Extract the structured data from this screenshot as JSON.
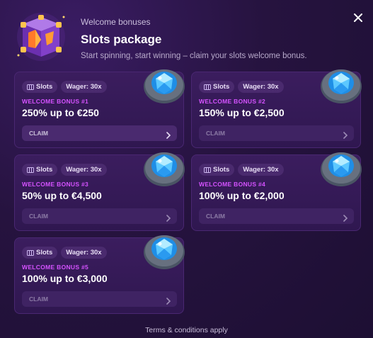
{
  "header": {
    "eyebrow": "Welcome bonuses",
    "title": "Slots package",
    "subtitle": "Start spinning, start winning – claim your slots welcome bonus."
  },
  "icons": {
    "close": "close-icon",
    "chest": "treasure-chest-icon",
    "gem": "blue-gem-icon",
    "slots": "slots-icon",
    "chevron": "chevron-right-icon"
  },
  "colors": {
    "accent_label": "#d552ff",
    "card_bg": "#3b1d5e",
    "modal_bg": "#26133f"
  },
  "cards": [
    {
      "tag_slots": "Slots",
      "tag_wager": "Wager: 30x",
      "label": "WELCOME BONUS #1",
      "amount": "250% up to €250",
      "claim": "CLAIM"
    },
    {
      "tag_slots": "Slots",
      "tag_wager": "Wager: 30x",
      "label": "WELCOME BONUS #2",
      "amount": "150% up to €2,500",
      "claim": "CLAIM"
    },
    {
      "tag_slots": "Slots",
      "tag_wager": "Wager: 30x",
      "label": "WELCOME BONUS #3",
      "amount": "50% up to €4,500",
      "claim": "CLAIM"
    },
    {
      "tag_slots": "Slots",
      "tag_wager": "Wager: 30x",
      "label": "WELCOME BONUS #4",
      "amount": "100% up to €2,000",
      "claim": "CLAIM"
    },
    {
      "tag_slots": "Slots",
      "tag_wager": "Wager: 30x",
      "label": "WELCOME BONUS #5",
      "amount": "100% up to €3,000",
      "claim": "CLAIM"
    }
  ],
  "footer": {
    "terms": "Terms & conditions apply"
  }
}
